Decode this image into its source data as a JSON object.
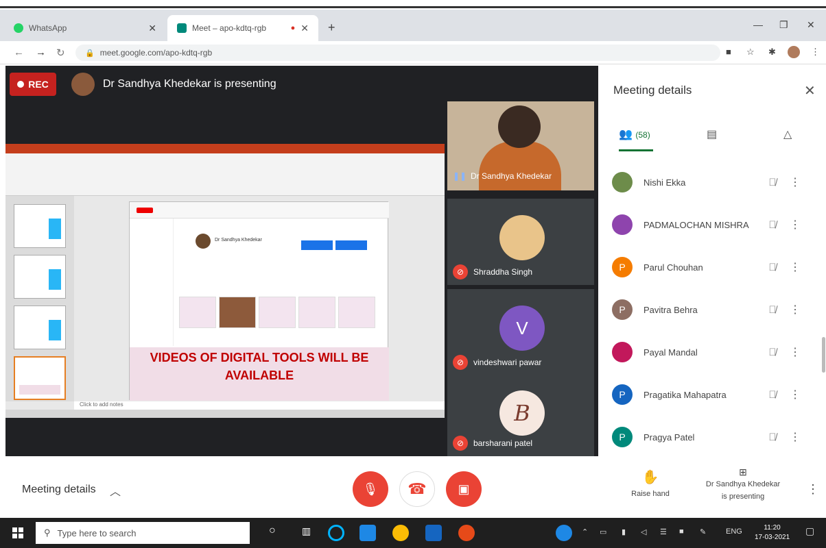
{
  "browser": {
    "tabs": [
      {
        "label": "WhatsApp",
        "color": "#25d366"
      },
      {
        "label": "Meet – apo-kdtq-rgb",
        "color": "#00897b"
      }
    ],
    "url": "meet.google.com/apo-kdtq-rgb"
  },
  "meet": {
    "rec_label": "REC",
    "presenting_banner": "Dr Sandhya Khedekar is presenting",
    "slide_caption": "VIDEOS OF DIGITAL TOOLS WILL BE AVAILABLE",
    "slide_notes": "Click to add notes",
    "yt_channel": "Dr Sandhya Khedekar",
    "tiles": [
      {
        "name": "Dr Sandhya Khedekar"
      },
      {
        "name": "Shraddha Singh",
        "initial": "",
        "color": "#e9c48a"
      },
      {
        "name": "vindeshwari pawar",
        "initial": "V",
        "color": "#7e57c2"
      },
      {
        "name": "barsharani patel",
        "initial": "B",
        "color": "#f6e8e0"
      }
    ]
  },
  "panel": {
    "title": "Meeting details",
    "people_count": "(58)",
    "participants": [
      {
        "name": "Nishi Ekka",
        "initial": "",
        "color": "#6d8c4a"
      },
      {
        "name": "PADMALOCHAN MISHRA",
        "initial": "",
        "color": "#8e44ad"
      },
      {
        "name": "Parul Chouhan",
        "initial": "P",
        "color": "#f57c00"
      },
      {
        "name": "Pavitra Behra",
        "initial": "P",
        "color": "#8d6e63"
      },
      {
        "name": "Payal Mandal",
        "initial": "",
        "color": "#c2185b"
      },
      {
        "name": "Pragatika Mahapatra",
        "initial": "P",
        "color": "#1565c0"
      },
      {
        "name": "Pragya Patel",
        "initial": "P",
        "color": "#00897b"
      }
    ]
  },
  "bottom": {
    "meeting_details": "Meeting details",
    "raise_hand": "Raise hand",
    "presenting_line1": "Dr Sandhya Khedekar",
    "presenting_line2": "is presenting"
  },
  "taskbar": {
    "search_placeholder": "Type here to search",
    "lang": "ENG",
    "time": "11:20",
    "date": "17-03-2021"
  }
}
